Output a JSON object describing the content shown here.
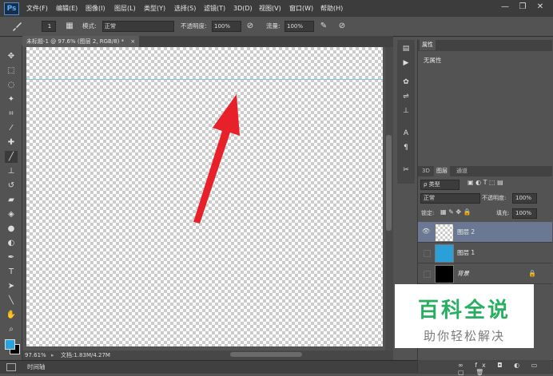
{
  "app": {
    "logo": "Ps"
  },
  "menu": [
    "文件(F)",
    "编辑(E)",
    "图像(I)",
    "图层(L)",
    "类型(Y)",
    "选择(S)",
    "滤镜(T)",
    "3D(D)",
    "视图(V)",
    "窗口(W)",
    "帮助(H)"
  ],
  "window_controls": {
    "minimize": "—",
    "restore": "❐",
    "close": "✕"
  },
  "options": {
    "brush_size": "1",
    "mode_label": "模式:",
    "mode_value": "正常",
    "opacity_label": "不透明度:",
    "opacity_value": "100%",
    "flow_label": "流量:",
    "flow_value": "100%"
  },
  "document": {
    "tab_title": "未标题-1 @ 97.6% (图层 2, RGB/8) *",
    "zoom": "97.61%",
    "doc_info": "文档:1.83M/4.27M",
    "timeline": "时间轴"
  },
  "properties": {
    "tab": "属性",
    "content": "无属性"
  },
  "layers": {
    "tabs": [
      "3D",
      "图层",
      "通道"
    ],
    "filter": "ρ 类型",
    "blend_mode": "正常",
    "opacity_label": "不透明度:",
    "opacity_value": "100%",
    "lock_label": "锁定:",
    "fill_label": "填充:",
    "fill_value": "100%",
    "items": [
      {
        "name": "图层 2",
        "selected": true,
        "thumb": "transparent"
      },
      {
        "name": "图层 1",
        "selected": false,
        "thumb": "#2a9fd8"
      },
      {
        "name": "背景",
        "selected": false,
        "thumb": "#000000",
        "locked": true
      }
    ]
  },
  "watermark": {
    "title": "百科全说",
    "subtitle": "助你轻松解决"
  },
  "colors": {
    "foreground": "#29a3e0",
    "background": "#000000",
    "arrow": "#e8202a"
  }
}
